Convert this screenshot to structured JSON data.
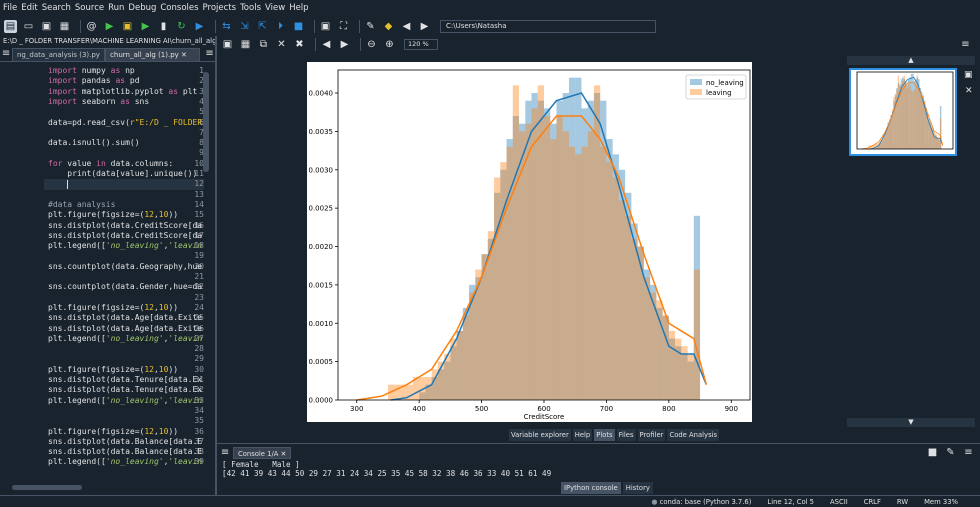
{
  "menu": [
    "File",
    "Edit",
    "Search",
    "Source",
    "Run",
    "Debug",
    "Consoles",
    "Projects",
    "Tools",
    "View",
    "Help"
  ],
  "toolbar": {
    "path": "C:\\Users\\Natasha"
  },
  "editor": {
    "path": "E:\\D _ FOLDER TRANSFER\\MACHINE LEARNING AI\\churn_all_alg (1).py",
    "tabs": [
      "ng_data_analysis (3).py",
      "churn_all_alg (1).py"
    ],
    "lines": [
      {
        "n": "1",
        "code": "import numpy as np"
      },
      {
        "n": "2",
        "code": "import pandas as pd"
      },
      {
        "n": "3",
        "code": "import matplotlib.pyplot as plt"
      },
      {
        "n": "4",
        "code": "import seaborn as sns"
      },
      {
        "n": "5",
        "code": ""
      },
      {
        "n": "6",
        "code": "data=pd.read_csv(r\"E:/D _ FOLDER"
      },
      {
        "n": "7",
        "code": ""
      },
      {
        "n": "8",
        "code": "data.isnull().sum()"
      },
      {
        "n": "9",
        "code": ""
      },
      {
        "n": "10",
        "code": "for value in data.columns:"
      },
      {
        "n": "11",
        "code": "    print(data[value].unique())"
      },
      {
        "n": "12",
        "code": "    "
      },
      {
        "n": "13",
        "code": ""
      },
      {
        "n": "14",
        "code": "#data analysis"
      },
      {
        "n": "15",
        "code": "plt.figure(figsize=(12,10))"
      },
      {
        "n": "16",
        "code": "sns.distplot(data.CreditScore[da"
      },
      {
        "n": "17",
        "code": "sns.distplot(data.CreditScore[da"
      },
      {
        "n": "18",
        "code": "plt.legend(['no_leaving','leavin"
      },
      {
        "n": "19",
        "code": ""
      },
      {
        "n": "20",
        "code": "sns.countplot(data.Geography,hue"
      },
      {
        "n": "21",
        "code": ""
      },
      {
        "n": "22",
        "code": "sns.countplot(data.Gender,hue=da"
      },
      {
        "n": "23",
        "code": ""
      },
      {
        "n": "24",
        "code": "plt.figure(figsize=(12,10))"
      },
      {
        "n": "25",
        "code": "sns.distplot(data.Age[data.Exite"
      },
      {
        "n": "26",
        "code": "sns.distplot(data.Age[data.Exite"
      },
      {
        "n": "27",
        "code": "plt.legend(['no_leaving','leavin"
      },
      {
        "n": "28",
        "code": ""
      },
      {
        "n": "29",
        "code": ""
      },
      {
        "n": "30",
        "code": "plt.figure(figsize=(12,10))"
      },
      {
        "n": "31",
        "code": "sns.distplot(data.Tenure[data.Ex"
      },
      {
        "n": "32",
        "code": "sns.distplot(data.Tenure[data.Ex"
      },
      {
        "n": "33",
        "code": "plt.legend(['no_leaving','leavin"
      },
      {
        "n": "34",
        "code": ""
      },
      {
        "n": "35",
        "code": ""
      },
      {
        "n": "36",
        "code": "plt.figure(figsize=(12,10))"
      },
      {
        "n": "37",
        "code": "sns.distplot(data.Balance[data.E"
      },
      {
        "n": "38",
        "code": "sns.distplot(data.Balance[data.E"
      },
      {
        "n": "39",
        "code": "plt.legend(['no_leaving','leavin"
      }
    ]
  },
  "plots": {
    "zoom": "120 %"
  },
  "pane_tabs": [
    "Variable explorer",
    "Help",
    "Plots",
    "Files",
    "Profiler",
    "Code Analysis"
  ],
  "console": {
    "tab": "Console 1/A",
    "lines": [
      "[ Female   Male ]",
      "[42 41 39 43 44 50 29 27 31 24 34 25 35 45 58 32 38 46 36 33 40 51 61 49"
    ],
    "bottom_tabs": [
      "IPython console",
      "History"
    ]
  },
  "status": [
    "conda: base (Python 3.7.6)",
    "Line 12, Col 5",
    "ASCII",
    "CRLF",
    "RW",
    "Mem 33%"
  ],
  "chart_data": {
    "type": "bar",
    "xlabel": "CreditScore",
    "ylabel": "",
    "xlim": [
      270,
      930
    ],
    "ylim": [
      0,
      0.0043
    ],
    "xticks": [
      300,
      400,
      500,
      600,
      700,
      800,
      900
    ],
    "yticks": [
      0.0,
      0.0005,
      0.001,
      0.0015,
      0.002,
      0.0025,
      0.003,
      0.0035,
      0.004
    ],
    "ytick_labels": [
      "0.0000",
      "0.0005",
      "0.0010",
      "0.0015",
      "0.0020",
      "0.0025",
      "0.0030",
      "0.0035",
      "0.0040"
    ],
    "legend_position": "top-right",
    "series": [
      {
        "name": "no_leaving",
        "color": "#1f77b4",
        "bins": [
          [
            400,
            410,
            0.0001
          ],
          [
            410,
            420,
            0.0002
          ],
          [
            420,
            430,
            0.0003
          ],
          [
            430,
            440,
            0.0004
          ],
          [
            440,
            450,
            0.0005
          ],
          [
            450,
            460,
            0.0007
          ],
          [
            460,
            470,
            0.0009
          ],
          [
            470,
            480,
            0.0012
          ],
          [
            480,
            490,
            0.0015
          ],
          [
            490,
            500,
            0.0016
          ],
          [
            500,
            510,
            0.0019
          ],
          [
            510,
            520,
            0.0021
          ],
          [
            520,
            530,
            0.0027
          ],
          [
            530,
            540,
            0.003
          ],
          [
            540,
            550,
            0.0034
          ],
          [
            550,
            560,
            0.0037
          ],
          [
            560,
            570,
            0.0036
          ],
          [
            570,
            580,
            0.0039
          ],
          [
            580,
            590,
            0.004
          ],
          [
            590,
            600,
            0.0039
          ],
          [
            600,
            610,
            0.0038
          ],
          [
            610,
            620,
            0.0036
          ],
          [
            620,
            630,
            0.0039
          ],
          [
            630,
            640,
            0.004
          ],
          [
            640,
            650,
            0.0042
          ],
          [
            650,
            660,
            0.0042
          ],
          [
            660,
            670,
            0.0038
          ],
          [
            670,
            680,
            0.0039
          ],
          [
            680,
            690,
            0.004
          ],
          [
            690,
            700,
            0.0039
          ],
          [
            700,
            710,
            0.0034
          ],
          [
            710,
            720,
            0.0032
          ],
          [
            720,
            730,
            0.003
          ],
          [
            730,
            740,
            0.0027
          ],
          [
            740,
            750,
            0.0023
          ],
          [
            750,
            760,
            0.002
          ],
          [
            760,
            770,
            0.0017
          ],
          [
            770,
            780,
            0.0015
          ],
          [
            780,
            790,
            0.0012
          ],
          [
            790,
            800,
            0.0011
          ],
          [
            800,
            810,
            0.0008
          ],
          [
            810,
            820,
            0.0007
          ],
          [
            820,
            830,
            0.0006
          ],
          [
            830,
            840,
            0.0005
          ],
          [
            840,
            850,
            0.0024
          ]
        ],
        "curve_x": [
          355,
          380,
          420,
          460,
          500,
          540,
          580,
          620,
          660,
          690,
          720,
          760,
          800,
          820,
          840,
          860
        ],
        "curve_y": [
          0.0,
          3e-05,
          0.0002,
          0.0008,
          0.0016,
          0.0026,
          0.0035,
          0.0039,
          0.004,
          0.0036,
          0.0028,
          0.0016,
          0.0007,
          0.0006,
          0.0006,
          0.0002
        ]
      },
      {
        "name": "leaving",
        "color": "#ff7f0e",
        "bins": [
          [
            350,
            370,
            0.0002
          ],
          [
            370,
            390,
            0.0002
          ],
          [
            390,
            410,
            0.0003
          ],
          [
            410,
            420,
            0.0003
          ],
          [
            420,
            430,
            0.0004
          ],
          [
            430,
            440,
            0.0005
          ],
          [
            440,
            450,
            0.0006
          ],
          [
            450,
            460,
            0.0008
          ],
          [
            460,
            470,
            0.0009
          ],
          [
            470,
            480,
            0.0011
          ],
          [
            480,
            490,
            0.0014
          ],
          [
            490,
            500,
            0.0017
          ],
          [
            500,
            510,
            0.0019
          ],
          [
            510,
            520,
            0.0022
          ],
          [
            520,
            530,
            0.0029
          ],
          [
            530,
            540,
            0.0031
          ],
          [
            540,
            550,
            0.0033
          ],
          [
            550,
            560,
            0.0041
          ],
          [
            560,
            570,
            0.0035
          ],
          [
            570,
            580,
            0.0036
          ],
          [
            580,
            590,
            0.0038
          ],
          [
            590,
            600,
            0.0041
          ],
          [
            600,
            610,
            0.0037
          ],
          [
            610,
            620,
            0.0034
          ],
          [
            620,
            630,
            0.0037
          ],
          [
            630,
            640,
            0.0035
          ],
          [
            640,
            650,
            0.0033
          ],
          [
            650,
            660,
            0.0032
          ],
          [
            660,
            670,
            0.0033
          ],
          [
            670,
            680,
            0.0035
          ],
          [
            680,
            690,
            0.0041
          ],
          [
            690,
            700,
            0.0033
          ],
          [
            700,
            710,
            0.0031
          ],
          [
            710,
            720,
            0.0029
          ],
          [
            720,
            730,
            0.0026
          ],
          [
            730,
            740,
            0.0024
          ],
          [
            740,
            750,
            0.0021
          ],
          [
            750,
            760,
            0.002
          ],
          [
            760,
            770,
            0.0016
          ],
          [
            770,
            780,
            0.0014
          ],
          [
            780,
            790,
            0.0013
          ],
          [
            790,
            800,
            0.0011
          ],
          [
            800,
            810,
            0.0009
          ],
          [
            810,
            820,
            0.0008
          ],
          [
            820,
            830,
            0.0007
          ],
          [
            830,
            840,
            0.0006
          ],
          [
            840,
            850,
            0.0017
          ]
        ],
        "curve_x": [
          300,
          340,
          380,
          420,
          460,
          500,
          540,
          580,
          620,
          660,
          690,
          720,
          760,
          800,
          820,
          840,
          860
        ],
        "curve_y": [
          0.0,
          5e-05,
          0.0002,
          0.0004,
          0.0009,
          0.0016,
          0.0025,
          0.0033,
          0.0037,
          0.0037,
          0.0034,
          0.0029,
          0.0019,
          0.001,
          0.0009,
          0.0008,
          0.0002
        ]
      }
    ]
  }
}
